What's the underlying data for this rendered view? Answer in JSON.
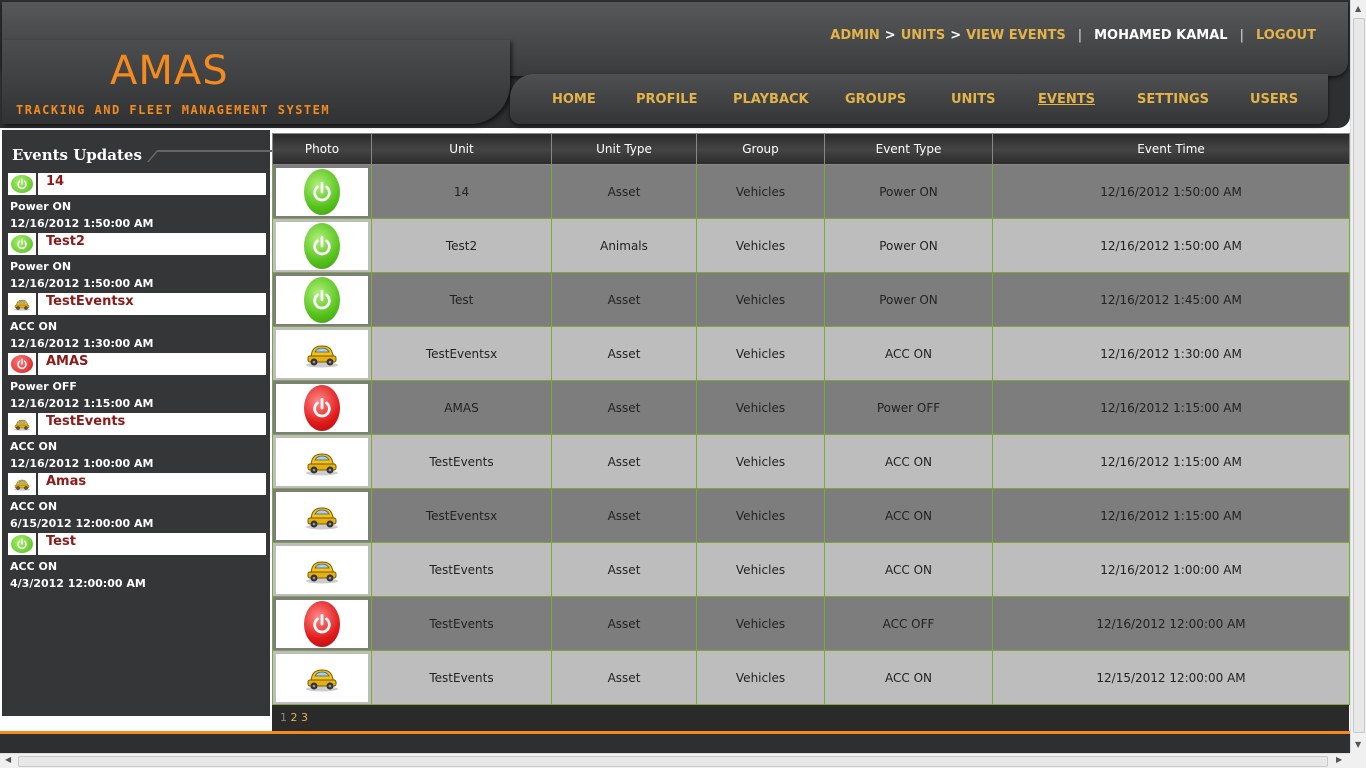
{
  "brand": {
    "title": "AMAS",
    "subtitle": "TRACKING AND FLEET MANAGEMENT SYSTEM",
    "accent_color": "#f58a1f",
    "link_color": "#e4b448"
  },
  "breadcrumb": {
    "items": [
      "ADMIN",
      "UNITS",
      "VIEW EVENTS"
    ],
    "separator": ">"
  },
  "user": {
    "name": "MOHAMED KAMAL",
    "logout_label": "LOGOUT",
    "divider": "|"
  },
  "nav": {
    "items": [
      "HOME",
      "PROFILE",
      "PLAYBACK",
      "GROUPS",
      "UNITS",
      "EVENTS",
      "SETTINGS",
      "USERS"
    ],
    "active": "EVENTS"
  },
  "sidebar": {
    "title": "Events Updates",
    "items": [
      {
        "name": "14",
        "icon": "power-on-icon",
        "event": "Power ON",
        "time": "12/16/2012 1:50:00 AM"
      },
      {
        "name": "Test2",
        "icon": "power-on-icon",
        "event": "Power ON",
        "time": "12/16/2012 1:50:00 AM"
      },
      {
        "name": "TestEventsx",
        "icon": "car-icon",
        "event": "ACC ON",
        "time": "12/16/2012 1:30:00 AM"
      },
      {
        "name": "AMAS",
        "icon": "power-off-icon",
        "event": "Power OFF",
        "time": "12/16/2012 1:15:00 AM"
      },
      {
        "name": "TestEvents",
        "icon": "car-icon",
        "event": "ACC ON",
        "time": "12/16/2012 1:00:00 AM"
      },
      {
        "name": "Amas",
        "icon": "car-icon",
        "event": "ACC ON",
        "time": "6/15/2012 12:00:00 AM"
      },
      {
        "name": "Test",
        "icon": "power-on-icon",
        "event": "ACC ON",
        "time": "4/3/2012 12:00:00 AM"
      }
    ]
  },
  "table": {
    "columns": [
      "Photo",
      "Unit",
      "Unit Type",
      "Group",
      "Event Type",
      "Event Time"
    ],
    "rows": [
      {
        "photo": "power-on-icon",
        "unit": "14",
        "unit_type": "Asset",
        "group": "Vehicles",
        "event_type": "Power ON",
        "event_time": "12/16/2012 1:50:00 AM"
      },
      {
        "photo": "power-on-icon",
        "unit": "Test2",
        "unit_type": "Animals",
        "group": "Vehicles",
        "event_type": "Power ON",
        "event_time": "12/16/2012 1:50:00 AM"
      },
      {
        "photo": "power-on-icon",
        "unit": "Test",
        "unit_type": "Asset",
        "group": "Vehicles",
        "event_type": "Power ON",
        "event_time": "12/16/2012 1:45:00 AM"
      },
      {
        "photo": "car-icon",
        "unit": "TestEventsx",
        "unit_type": "Asset",
        "group": "Vehicles",
        "event_type": "ACC ON",
        "event_time": "12/16/2012 1:30:00 AM"
      },
      {
        "photo": "power-off-icon",
        "unit": "AMAS",
        "unit_type": "Asset",
        "group": "Vehicles",
        "event_type": "Power OFF",
        "event_time": "12/16/2012 1:15:00 AM"
      },
      {
        "photo": "car-icon",
        "unit": "TestEvents",
        "unit_type": "Asset",
        "group": "Vehicles",
        "event_type": "ACC ON",
        "event_time": "12/16/2012 1:15:00 AM"
      },
      {
        "photo": "car-icon",
        "unit": "TestEventsx",
        "unit_type": "Asset",
        "group": "Vehicles",
        "event_type": "ACC ON",
        "event_time": "12/16/2012 1:15:00 AM"
      },
      {
        "photo": "car-icon",
        "unit": "TestEvents",
        "unit_type": "Asset",
        "group": "Vehicles",
        "event_type": "ACC ON",
        "event_time": "12/16/2012 1:00:00 AM"
      },
      {
        "photo": "power-off-icon",
        "unit": "TestEvents",
        "unit_type": "Asset",
        "group": "Vehicles",
        "event_type": "ACC OFF",
        "event_time": "12/16/2012 12:00:00 AM"
      },
      {
        "photo": "car-icon",
        "unit": "TestEvents",
        "unit_type": "Asset",
        "group": "Vehicles",
        "event_type": "ACC ON",
        "event_time": "12/15/2012 12:00:00 AM"
      }
    ]
  },
  "pagination": {
    "pages": [
      "1",
      "2",
      "3"
    ],
    "current": "1"
  }
}
